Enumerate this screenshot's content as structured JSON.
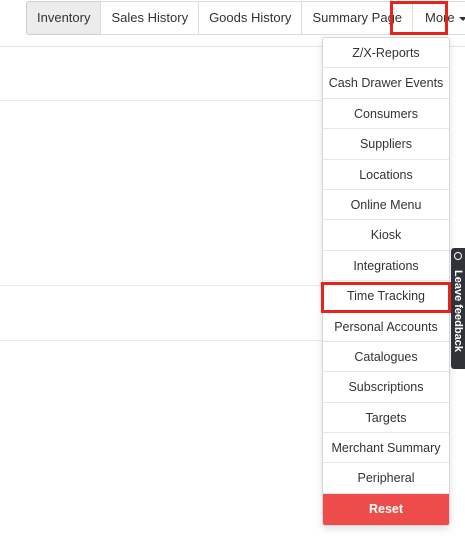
{
  "tabs": [
    {
      "label": "Inventory",
      "active": true
    },
    {
      "label": "Sales History",
      "active": false
    },
    {
      "label": "Goods History",
      "active": false
    },
    {
      "label": "Summary Page",
      "active": false
    }
  ],
  "more_tab": {
    "label": "More",
    "icon": "caret-down-icon"
  },
  "dropdown": {
    "items": [
      "Z/X-Reports",
      "Cash Drawer Events",
      "Consumers",
      "Suppliers",
      "Locations",
      "Online Menu",
      "Kiosk",
      "Integrations",
      "Time Tracking",
      "Personal Accounts",
      "Catalogues",
      "Subscriptions",
      "Targets",
      "Merchant Summary",
      "Peripheral"
    ],
    "reset_label": "Reset",
    "reset_color": "#ee4b4b"
  },
  "highlight_color": "#e8231c",
  "feedback_tab": {
    "label": "Leave feedback",
    "icon": "chat-bubble-icon"
  }
}
